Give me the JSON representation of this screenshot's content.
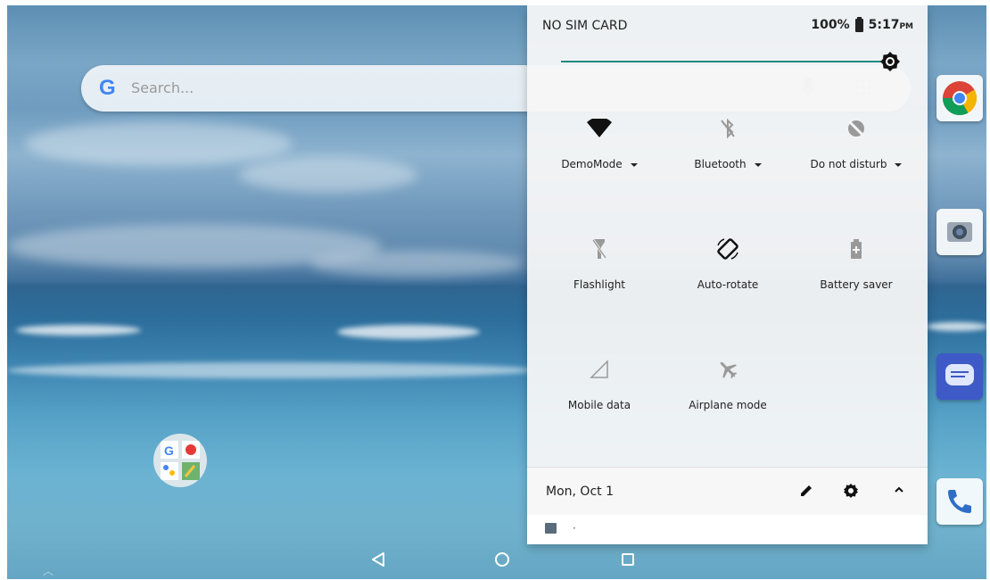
{
  "status_bar": {
    "carrier": "NO SIM CARD",
    "battery": "100%",
    "time": "5:17",
    "ampm": "PM"
  },
  "search": {
    "placeholder": "Search..."
  },
  "quick_settings": {
    "brightness_level": 1.0,
    "accent_color": "#1e8a7f",
    "tiles": [
      {
        "label": "DemoMode",
        "icon": "wifi-icon",
        "dropdown": true
      },
      {
        "label": "Bluetooth",
        "icon": "bluetooth-off-icon",
        "dropdown": true
      },
      {
        "label": "Do not disturb",
        "icon": "do-not-disturb-icon",
        "dropdown": true
      },
      {
        "label": "Flashlight",
        "icon": "flashlight-off-icon",
        "dropdown": false
      },
      {
        "label": "Auto-rotate",
        "icon": "auto-rotate-icon",
        "dropdown": false
      },
      {
        "label": "Battery saver",
        "icon": "battery-saver-icon",
        "dropdown": false
      },
      {
        "label": "Mobile data",
        "icon": "mobile-data-icon",
        "dropdown": false
      },
      {
        "label": "Airplane mode",
        "icon": "airplane-mode-icon",
        "dropdown": false
      }
    ],
    "footer": {
      "date": "Mon, Oct 1"
    },
    "notification": {
      "text": "·"
    }
  },
  "nav_bar": {
    "back": "back-icon",
    "home": "home-icon",
    "recents": "recents-icon"
  }
}
